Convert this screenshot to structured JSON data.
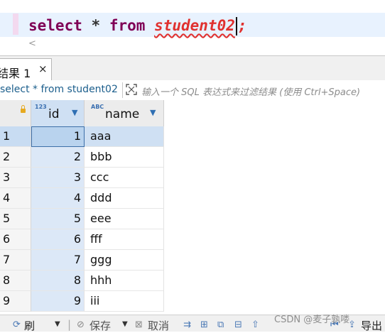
{
  "editor": {
    "kw_select": "select",
    "op_star": "*",
    "kw_from": "from",
    "table": "student02",
    "semicolon": ";",
    "scroll_left": "<"
  },
  "results_tab": {
    "label": "结果 1",
    "close": "×"
  },
  "filter": {
    "query": "select * from student02",
    "placeholder": "输入一个 SQL 表达式来过滤结果 (使用 Ctrl+Space)"
  },
  "grid": {
    "columns": [
      {
        "type": "123",
        "name": "id"
      },
      {
        "type": "ABC",
        "name": "name"
      }
    ],
    "rows": [
      {
        "rownum": "1",
        "id": "1",
        "name": "aaa"
      },
      {
        "rownum": "2",
        "id": "2",
        "name": "bbb"
      },
      {
        "rownum": "3",
        "id": "3",
        "name": "ccc"
      },
      {
        "rownum": "4",
        "id": "4",
        "name": "ddd"
      },
      {
        "rownum": "5",
        "id": "5",
        "name": "eee"
      },
      {
        "rownum": "6",
        "id": "6",
        "name": "fff"
      },
      {
        "rownum": "7",
        "id": "7",
        "name": "ggg"
      },
      {
        "rownum": "8",
        "id": "8",
        "name": "hhh"
      },
      {
        "rownum": "9",
        "id": "9",
        "name": "iii"
      }
    ],
    "selected_row": 1
  },
  "bottombar": {
    "refresh": "刷",
    "save": "保存",
    "cancel": "取消",
    "export": "导出"
  },
  "watermark": "CSDN @麦子孰喽"
}
